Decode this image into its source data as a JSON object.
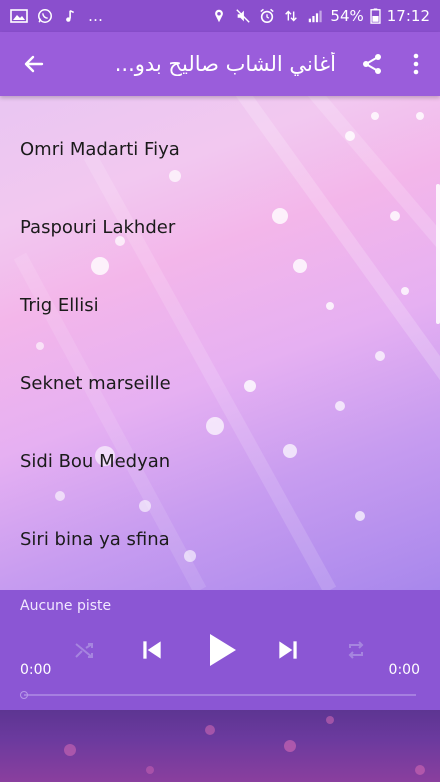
{
  "status_bar": {
    "battery": "54%",
    "time": "17:12",
    "left_icons": [
      "image-icon",
      "whatsapp-icon",
      "music-note-icon",
      "more-dots"
    ],
    "right_icons": [
      "location-icon",
      "mute-icon",
      "alarm-icon",
      "data-icon",
      "signal-icon",
      "battery-icon"
    ]
  },
  "app_bar": {
    "title": "أغاني الشاب صاليح بدو...",
    "back_icon": "arrow-back-icon",
    "share_icon": "share-icon",
    "more_icon": "more-vert-icon"
  },
  "songs": [
    {
      "title": "Omri Madarti Fiya"
    },
    {
      "title": "Paspouri Lakhder"
    },
    {
      "title": "Trig Ellisi"
    },
    {
      "title": "Seknet marseille"
    },
    {
      "title": "Sidi Bou Medyan"
    },
    {
      "title": "Siri bina ya sfina"
    }
  ],
  "player": {
    "track": "Aucune piste",
    "elapsed": "0:00",
    "duration": "0:00",
    "progress": 0,
    "controls": [
      "shuffle-icon",
      "skip-previous-icon",
      "play-icon",
      "skip-next-icon",
      "repeat-icon"
    ]
  },
  "colors": {
    "status_bar": "#8a4fcd",
    "app_bar": "#9a5ddb",
    "player": "#8b56d4",
    "list_text": "#1b1b1b"
  }
}
